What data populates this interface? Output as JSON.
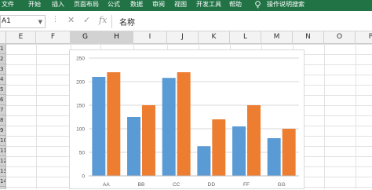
{
  "ribbon": {
    "tabs": [
      "文件",
      "开始",
      "插入",
      "页面布局",
      "公式",
      "数据",
      "审阅",
      "视图",
      "开发工具",
      "帮助"
    ],
    "tell_me": "操作说明搜索"
  },
  "formula_bar": {
    "name_box": "A1",
    "cancel_icon": "close-icon",
    "enter_icon": "check-icon",
    "fx_label": "fx",
    "value": "名称"
  },
  "columns": [
    "E",
    "F",
    "G",
    "H",
    "I",
    "J",
    "K",
    "L",
    "M",
    "N",
    "O",
    "P"
  ],
  "selected_columns": [
    "G",
    "H"
  ],
  "rows": [
    "1",
    "2",
    "3",
    "4",
    "5",
    "6",
    "7",
    "8",
    "9",
    "10",
    "11",
    "12",
    "13",
    "14"
  ],
  "colors": {
    "ribbon": "#217346",
    "series_1": "#5B9BD5",
    "series_2": "#ED7D31"
  },
  "chart_data": {
    "type": "bar",
    "categories": [
      "AA",
      "BB",
      "CC",
      "DD",
      "FF",
      "GG"
    ],
    "series": [
      {
        "values": [
          210,
          125,
          208,
          63,
          105,
          80
        ]
      },
      {
        "values": [
          220,
          150,
          220,
          120,
          150,
          100
        ]
      }
    ],
    "ylim": [
      0,
      250
    ],
    "yticks": [
      0,
      50,
      100,
      150,
      200,
      250
    ],
    "grid": true,
    "legend": "none"
  }
}
